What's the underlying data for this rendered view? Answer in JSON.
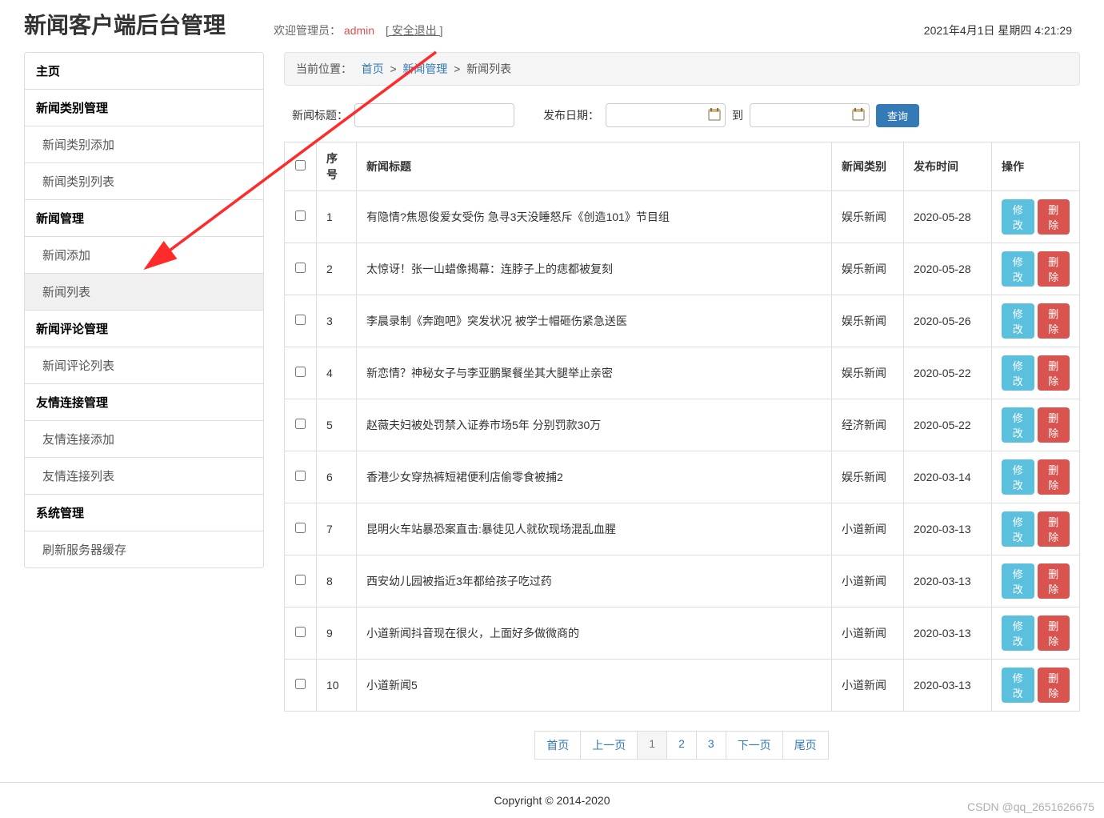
{
  "app": {
    "title": "新闻客户端后台管理"
  },
  "header": {
    "welcome_prefix": "欢迎管理员：",
    "admin_name": "admin",
    "logout_label": "[ 安全退出 ]",
    "datetime": "2021年4月1日 星期四 4:21:29"
  },
  "sidebar": {
    "items": [
      {
        "label": "主页",
        "type": "section"
      },
      {
        "label": "新闻类别管理",
        "type": "section"
      },
      {
        "label": "新闻类别添加",
        "type": "sub"
      },
      {
        "label": "新闻类别列表",
        "type": "sub"
      },
      {
        "label": "新闻管理",
        "type": "section"
      },
      {
        "label": "新闻添加",
        "type": "sub"
      },
      {
        "label": "新闻列表",
        "type": "sub",
        "active": true
      },
      {
        "label": "新闻评论管理",
        "type": "section"
      },
      {
        "label": "新闻评论列表",
        "type": "sub"
      },
      {
        "label": "友情连接管理",
        "type": "section"
      },
      {
        "label": "友情连接添加",
        "type": "sub"
      },
      {
        "label": "友情连接列表",
        "type": "sub"
      },
      {
        "label": "系统管理",
        "type": "section"
      },
      {
        "label": "刷新服务器缓存",
        "type": "sub"
      }
    ]
  },
  "breadcrumb": {
    "prefix": "当前位置：",
    "parts": [
      "首页",
      "新闻管理",
      "新闻列表"
    ],
    "sep": ">"
  },
  "filter": {
    "title_label": "新闻标题：",
    "date_label": "发布日期：",
    "to_label": "到",
    "search_label": "查询"
  },
  "table": {
    "headers": {
      "seq": "序号",
      "title": "新闻标题",
      "category": "新闻类别",
      "date": "发布时间",
      "ops": "操作"
    },
    "edit_label": "修改",
    "delete_label": "删除",
    "rows": [
      {
        "seq": "1",
        "title": "有隐情?焦恩俊爱女受伤 急寻3天没睡怒斥《创造101》节目组",
        "category": "娱乐新闻",
        "date": "2020-05-28"
      },
      {
        "seq": "2",
        "title": "太惊讶！张一山蜡像揭幕：连脖子上的痣都被复刻",
        "category": "娱乐新闻",
        "date": "2020-05-28"
      },
      {
        "seq": "3",
        "title": "李晨录制《奔跑吧》突发状况 被学士帽砸伤紧急送医",
        "category": "娱乐新闻",
        "date": "2020-05-26"
      },
      {
        "seq": "4",
        "title": "新恋情？神秘女子与李亚鹏聚餐坐其大腿举止亲密",
        "category": "娱乐新闻",
        "date": "2020-05-22"
      },
      {
        "seq": "5",
        "title": "赵薇夫妇被处罚禁入证券市场5年 分别罚款30万",
        "category": "经济新闻",
        "date": "2020-05-22"
      },
      {
        "seq": "6",
        "title": "香港少女穿热裤短裙便利店偷零食被捕2",
        "category": "娱乐新闻",
        "date": "2020-03-14"
      },
      {
        "seq": "7",
        "title": "昆明火车站暴恐案直击:暴徒见人就砍现场混乱血腥",
        "category": "小道新闻",
        "date": "2020-03-13"
      },
      {
        "seq": "8",
        "title": "西安幼儿园被指近3年都给孩子吃过药",
        "category": "小道新闻",
        "date": "2020-03-13"
      },
      {
        "seq": "9",
        "title": "小道新闻抖音现在很火，上面好多做微商的",
        "category": "小道新闻",
        "date": "2020-03-13"
      },
      {
        "seq": "10",
        "title": "小道新闻5",
        "category": "小道新闻",
        "date": "2020-03-13"
      }
    ]
  },
  "pagination": {
    "first": "首页",
    "prev": "上一页",
    "pages": [
      "1",
      "2",
      "3"
    ],
    "active": "1",
    "next": "下一页",
    "last": "尾页"
  },
  "footer": {
    "copyright": "Copyright © 2014-2020"
  },
  "watermark": "CSDN @qq_2651626675"
}
